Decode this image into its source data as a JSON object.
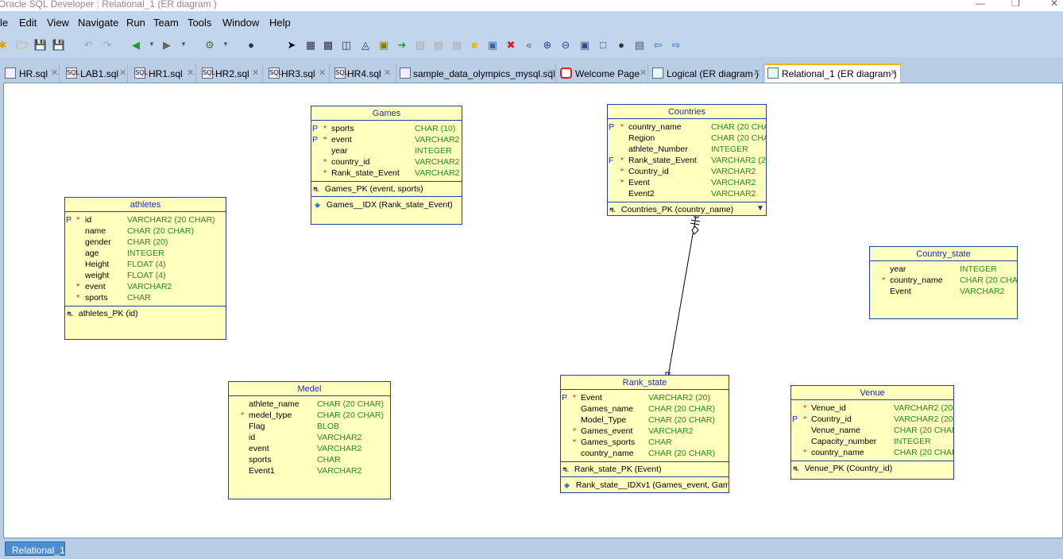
{
  "window": {
    "title": "Oracle SQL Developer : Relational_1 (ER diagram )"
  },
  "menus": [
    "le",
    "Edit",
    "View",
    "Navigate",
    "Run",
    "Team",
    "Tools",
    "Window",
    "Help"
  ],
  "tabs": [
    {
      "label": "HR.sql",
      "icon": "sql-worksheet-icon"
    },
    {
      "label": "LAB1.sql",
      "icon": "sql-worksheet-icon"
    },
    {
      "label": "HR1.sql",
      "icon": "sql-worksheet-icon"
    },
    {
      "label": "HR2.sql",
      "icon": "sql-worksheet-icon"
    },
    {
      "label": "HR3.sql",
      "icon": "sql-worksheet-icon"
    },
    {
      "label": "HR4.sql",
      "icon": "sql-worksheet-icon"
    },
    {
      "label": "sample_data_olympics_mysql.sql",
      "icon": "sql-file-icon"
    },
    {
      "label": "Welcome Page",
      "icon": "oracle-icon"
    },
    {
      "label": "Logical (ER diagram )",
      "icon": "diagram-icon"
    },
    {
      "label": "Relational_1 (ER diagram )",
      "icon": "diagram-icon",
      "active": true
    }
  ],
  "bottom_tab": "Relational_1",
  "entities": {
    "games": {
      "title": "Games",
      "columns": [
        {
          "flag": "P",
          "req": "*",
          "name": "sports",
          "type": "CHAR (10)"
        },
        {
          "flag": "P",
          "req": "*",
          "name": "event",
          "type": "VARCHAR2 ("
        },
        {
          "flag": "",
          "req": "",
          "name": "year",
          "type": "INTEGER"
        },
        {
          "flag": "",
          "req": "*",
          "name": "country_id",
          "type": "VARCHAR2 ("
        },
        {
          "flag": "",
          "req": "*",
          "name": "Rank_state_Event",
          "type": "VARCHAR2"
        }
      ],
      "pk": "Games_PK (event, sports)",
      "idx": "Games__IDX (Rank_state_Event)"
    },
    "countries": {
      "title": "Countries",
      "columns": [
        {
          "flag": "P",
          "req": "*",
          "name": "country_name",
          "type": "CHAR (20 CHA"
        },
        {
          "flag": "",
          "req": "",
          "name": "Region",
          "type": "CHAR (20 CHA"
        },
        {
          "flag": "",
          "req": "",
          "name": "athlete_Number",
          "type": "INTEGER"
        },
        {
          "flag": "F",
          "req": "*",
          "name": "Rank_state_Event",
          "type": "VARCHAR2 (20"
        },
        {
          "flag": "",
          "req": "*",
          "name": "Country_id",
          "type": "VARCHAR2"
        },
        {
          "flag": "",
          "req": "*",
          "name": "Event",
          "type": "VARCHAR2"
        },
        {
          "flag": "",
          "req": "",
          "name": "Event2",
          "type": "VARCHAR2"
        }
      ],
      "pk": "Countries_PK (country_name)"
    },
    "athletes": {
      "title": "athletes",
      "columns": [
        {
          "flag": "P",
          "req": "*",
          "name": "id",
          "type": "VARCHAR2 (20 CHAR)"
        },
        {
          "flag": "",
          "req": "",
          "name": "name",
          "type": "CHAR (20 CHAR)"
        },
        {
          "flag": "",
          "req": "",
          "name": "gender",
          "type": "CHAR (20)"
        },
        {
          "flag": "",
          "req": "",
          "name": "age",
          "type": "INTEGER"
        },
        {
          "flag": "",
          "req": "",
          "name": "Height",
          "type": "FLOAT (4)"
        },
        {
          "flag": "",
          "req": "",
          "name": "weight",
          "type": "FLOAT (4)"
        },
        {
          "flag": "",
          "req": "*",
          "name": "event",
          "type": "VARCHAR2"
        },
        {
          "flag": "",
          "req": "*",
          "name": "sports",
          "type": "CHAR"
        }
      ],
      "pk": "athletes_PK (id)"
    },
    "country_state": {
      "title": "Country_state",
      "columns": [
        {
          "flag": "",
          "req": "",
          "name": "year",
          "type": "INTEGER"
        },
        {
          "flag": "",
          "req": "*",
          "name": "country_name",
          "type": "CHAR (20 CHAR"
        },
        {
          "flag": "",
          "req": "",
          "name": "Event",
          "type": "VARCHAR2"
        }
      ]
    },
    "medel": {
      "title": "Medel",
      "columns": [
        {
          "flag": "",
          "req": "",
          "name": "athlete_name",
          "type": "CHAR (20 CHAR)"
        },
        {
          "flag": "",
          "req": "*",
          "name": "medel_type",
          "type": "CHAR (20 CHAR)"
        },
        {
          "flag": "",
          "req": "",
          "name": "Flag",
          "type": "BLOB"
        },
        {
          "flag": "",
          "req": "",
          "name": "id",
          "type": "VARCHAR2"
        },
        {
          "flag": "",
          "req": "",
          "name": "event",
          "type": "VARCHAR2"
        },
        {
          "flag": "",
          "req": "",
          "name": "sports",
          "type": "CHAR"
        },
        {
          "flag": "",
          "req": "",
          "name": "Event1",
          "type": "VARCHAR2"
        }
      ]
    },
    "rank_state": {
      "title": "Rank_state",
      "columns": [
        {
          "flag": "P",
          "req": "*",
          "name": "Event",
          "type": "VARCHAR2 (20)"
        },
        {
          "flag": "",
          "req": "",
          "name": "Games_name",
          "type": "CHAR (20 CHAR)"
        },
        {
          "flag": "",
          "req": "",
          "name": "Model_Type",
          "type": "CHAR (20 CHAR)"
        },
        {
          "flag": "",
          "req": "*",
          "name": "Games_event",
          "type": "VARCHAR2"
        },
        {
          "flag": "",
          "req": "*",
          "name": "Games_sports",
          "type": "CHAR"
        },
        {
          "flag": "",
          "req": "",
          "name": "country_name",
          "type": "CHAR (20 CHAR)"
        }
      ],
      "pk": "Rank_state_PK (Event)",
      "idx": "Rank_state__IDXv1 (Games_event, Game"
    },
    "venue": {
      "title": "Venue",
      "columns": [
        {
          "flag": "",
          "req": "*",
          "name": "Venue_id",
          "type": "VARCHAR2 (20"
        },
        {
          "flag": "P",
          "req": "*",
          "name": "Country_id",
          "type": "VARCHAR2 (20"
        },
        {
          "flag": "",
          "req": "",
          "name": "Venue_name",
          "type": "CHAR (20 CHAR"
        },
        {
          "flag": "",
          "req": "",
          "name": "Capacity_number",
          "type": "INTEGER"
        },
        {
          "flag": "",
          "req": "*",
          "name": "country_name",
          "type": "CHAR (20 CHAR"
        }
      ],
      "pk": "Venue_PK (Country_id)"
    }
  }
}
